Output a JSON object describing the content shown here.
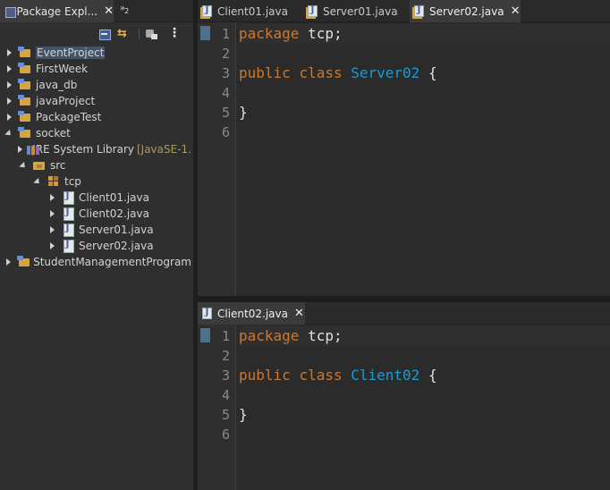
{
  "explorer": {
    "tab_label": "Package Expl...",
    "overflow_label": "»",
    "overflow_count": "2",
    "tree": [
      {
        "label": "EventProject",
        "icon": "project-icon",
        "depth": 0,
        "expanded": false,
        "selected": true
      },
      {
        "label": "FirstWeek",
        "icon": "project-icon",
        "depth": 0,
        "expanded": false
      },
      {
        "label": "java_db",
        "icon": "project-icon",
        "depth": 0,
        "expanded": false
      },
      {
        "label": "javaProject",
        "icon": "project-icon",
        "depth": 0,
        "expanded": false
      },
      {
        "label": "PackageTest",
        "icon": "project-icon",
        "depth": 0,
        "expanded": false
      },
      {
        "label": "socket",
        "icon": "project-icon",
        "depth": 0,
        "expanded": true
      },
      {
        "label": "JRE System Library",
        "decoration": "[JavaSE-1.",
        "icon": "library-icon",
        "depth": 1,
        "expanded": false
      },
      {
        "label": "src",
        "icon": "source-folder-icon",
        "depth": 1,
        "expanded": true
      },
      {
        "label": "tcp",
        "icon": "package-icon",
        "depth": 2,
        "expanded": true
      },
      {
        "label": "Client01.java",
        "icon": "java-file-icon",
        "depth": 3,
        "expanded": false
      },
      {
        "label": "Client02.java",
        "icon": "java-file-icon",
        "depth": 3,
        "expanded": false
      },
      {
        "label": "Server01.java",
        "icon": "java-file-icon",
        "depth": 3,
        "expanded": false
      },
      {
        "label": "Server02.java",
        "icon": "java-file-icon",
        "depth": 3,
        "expanded": false
      },
      {
        "label": "StudentManagementProgram",
        "icon": "project-icon",
        "depth": 0,
        "expanded": false
      }
    ]
  },
  "editor_top": {
    "tabs": [
      {
        "label": "Client01.java",
        "active": false
      },
      {
        "label": "Server01.java",
        "active": false
      },
      {
        "label": "Server02.java",
        "active": true
      }
    ],
    "lines": [
      {
        "no": "1",
        "tokens": [
          {
            "t": "package",
            "c": "kw"
          },
          {
            "t": " tcp;",
            "c": "plain"
          }
        ]
      },
      {
        "no": "2",
        "tokens": []
      },
      {
        "no": "3",
        "tokens": [
          {
            "t": "public",
            "c": "kw"
          },
          {
            "t": " ",
            "c": "plain"
          },
          {
            "t": "class",
            "c": "kw"
          },
          {
            "t": " ",
            "c": "plain"
          },
          {
            "t": "Server02",
            "c": "cls"
          },
          {
            "t": " {",
            "c": "plain"
          }
        ]
      },
      {
        "no": "4",
        "tokens": []
      },
      {
        "no": "5",
        "tokens": [
          {
            "t": "}",
            "c": "plain"
          }
        ]
      },
      {
        "no": "6",
        "tokens": []
      }
    ]
  },
  "editor_bottom": {
    "tabs": [
      {
        "label": "Client02.java",
        "active": true
      }
    ],
    "lines": [
      {
        "no": "1",
        "tokens": [
          {
            "t": "package",
            "c": "kw"
          },
          {
            "t": " tcp;",
            "c": "plain"
          }
        ]
      },
      {
        "no": "2",
        "tokens": []
      },
      {
        "no": "3",
        "tokens": [
          {
            "t": "public",
            "c": "kw"
          },
          {
            "t": " ",
            "c": "plain"
          },
          {
            "t": "class",
            "c": "kw"
          },
          {
            "t": " ",
            "c": "plain"
          },
          {
            "t": "Client02",
            "c": "cls"
          },
          {
            "t": " {",
            "c": "plain"
          }
        ]
      },
      {
        "no": "4",
        "tokens": []
      },
      {
        "no": "5",
        "tokens": [
          {
            "t": "}",
            "c": "plain"
          }
        ]
      },
      {
        "no": "6",
        "tokens": []
      }
    ]
  },
  "colors": {
    "keyword": "#cc7832",
    "class_name": "#1e9ad6",
    "background": "#2b2b2b"
  }
}
